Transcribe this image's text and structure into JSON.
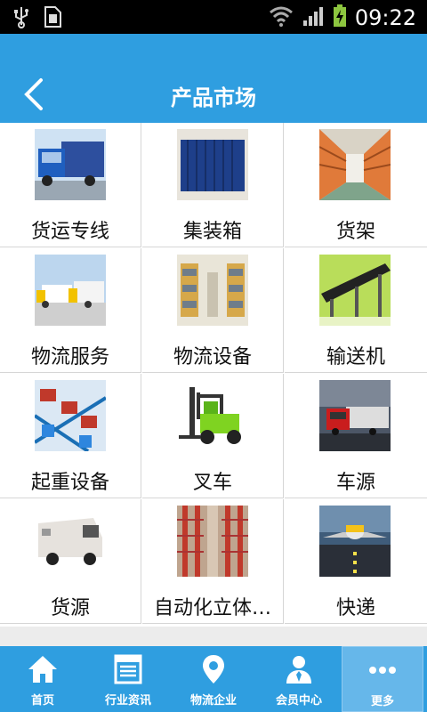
{
  "status_bar": {
    "time": "09:22"
  },
  "header": {
    "title": "产品市场"
  },
  "products": [
    {
      "label": "货运专线",
      "icon": "freight-truck-image"
    },
    {
      "label": "集装箱",
      "icon": "container-image"
    },
    {
      "label": "货架",
      "icon": "shelf-image"
    },
    {
      "label": "物流服务",
      "icon": "logistics-trucks-image"
    },
    {
      "label": "物流设备",
      "icon": "warehouse-image"
    },
    {
      "label": "输送机",
      "icon": "conveyor-image"
    },
    {
      "label": "起重设备",
      "icon": "lifting-platform-image"
    },
    {
      "label": "叉车",
      "icon": "forklift-image"
    },
    {
      "label": "车源",
      "icon": "red-truck-image"
    },
    {
      "label": "货源",
      "icon": "delivery-van-image"
    },
    {
      "label": "自动化立体…",
      "icon": "automated-storage-image"
    },
    {
      "label": "快递",
      "icon": "cargo-plane-image"
    }
  ],
  "tabs": [
    {
      "label": "首页",
      "icon": "home-icon"
    },
    {
      "label": "行业资讯",
      "icon": "news-icon"
    },
    {
      "label": "物流企业",
      "icon": "location-pin-icon"
    },
    {
      "label": "会员中心",
      "icon": "member-icon"
    },
    {
      "label": "更多",
      "icon": "more-icon",
      "active": true
    }
  ],
  "colors": {
    "accent": "#2f9ee0",
    "active_tab": "#66b7ea"
  }
}
